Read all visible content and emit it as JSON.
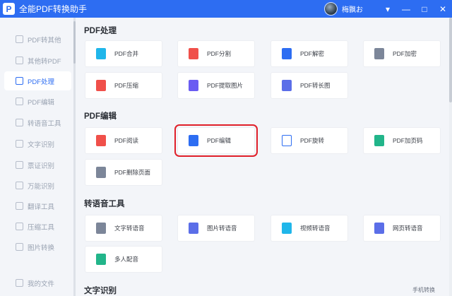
{
  "app": {
    "title": "全能PDF转换助手",
    "logo_letter": "P",
    "username": "梅飘お",
    "window_controls": [
      "▾",
      "—",
      "□",
      "✕"
    ]
  },
  "sidebar": {
    "items": [
      {
        "label": "PDF转其他",
        "icon": "convert-icon"
      },
      {
        "label": "其他转PDF",
        "icon": "import-icon"
      },
      {
        "label": "PDF处理",
        "icon": "process-icon",
        "active": true
      },
      {
        "label": "PDF编辑",
        "icon": "edit-icon"
      },
      {
        "label": "转语音工具",
        "icon": "speech-icon"
      },
      {
        "label": "文字识别",
        "icon": "text-recog-icon"
      },
      {
        "label": "票证识别",
        "icon": "ticket-icon"
      },
      {
        "label": "万能识别",
        "icon": "scan-icon"
      },
      {
        "label": "翻译工具",
        "icon": "translate-icon"
      },
      {
        "label": "压缩工具",
        "icon": "compress-icon"
      },
      {
        "label": "图片转换",
        "icon": "image-icon"
      },
      {
        "label": "我的文件",
        "icon": "folder-icon"
      }
    ]
  },
  "sections": [
    {
      "title": "PDF处理",
      "cards": [
        {
          "label": "PDF合并",
          "icon": "merge-icon",
          "color": "cyan"
        },
        {
          "label": "PDF分割",
          "icon": "split-icon",
          "color": "red"
        },
        {
          "label": "PDF解密",
          "icon": "unlock-icon",
          "color": "blue"
        },
        {
          "label": "PDF加密",
          "icon": "lock-icon",
          "color": "gray"
        },
        {
          "label": "PDF压缩",
          "icon": "compress-icon",
          "color": "red"
        },
        {
          "label": "PDF提取图片",
          "icon": "extract-image-icon",
          "color": "purple"
        },
        {
          "label": "PDF转长图",
          "icon": "long-image-icon",
          "color": "indigo"
        }
      ]
    },
    {
      "title": "PDF编辑",
      "cards": [
        {
          "label": "PDF阅读",
          "icon": "read-icon",
          "color": "red"
        },
        {
          "label": "PDF编辑",
          "icon": "edit-icon",
          "color": "blue",
          "highlighted": true
        },
        {
          "label": "PDF旋转",
          "icon": "rotate-icon",
          "color": "outline-blue"
        },
        {
          "label": "PDF加页码",
          "icon": "page-number-icon",
          "color": "teal"
        },
        {
          "label": "PDF删除页面",
          "icon": "delete-page-icon",
          "color": "gray"
        }
      ]
    },
    {
      "title": "转语音工具",
      "cards": [
        {
          "label": "文字转语音",
          "icon": "text-to-speech-icon",
          "color": "gray"
        },
        {
          "label": "图片转语音",
          "icon": "image-to-speech-icon",
          "color": "indigo"
        },
        {
          "label": "视频转语音",
          "icon": "video-to-speech-icon",
          "color": "cyan"
        },
        {
          "label": "网页转语音",
          "icon": "web-to-speech-icon",
          "color": "indigo"
        },
        {
          "label": "多人配音",
          "icon": "multi-voice-icon",
          "color": "teal"
        }
      ]
    },
    {
      "title": "文字识别",
      "cards": []
    }
  ],
  "footer_link": "手机转换"
}
